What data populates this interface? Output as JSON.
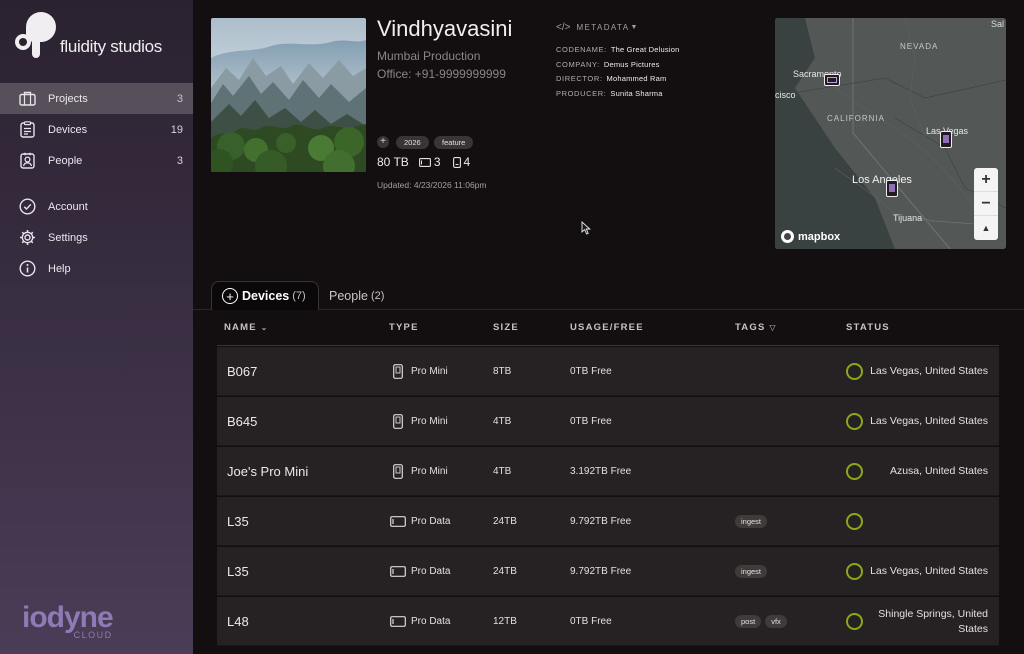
{
  "sidebar": {
    "brand": "fluidity studios",
    "items": [
      {
        "label": "Projects",
        "count": "3",
        "icon": "briefcase-icon"
      },
      {
        "label": "Devices",
        "count": "19",
        "icon": "clipboard-icon"
      },
      {
        "label": "People",
        "count": "3",
        "icon": "person-badge-icon"
      },
      {
        "label": "Account",
        "icon": "check-circle-icon"
      },
      {
        "label": "Settings",
        "icon": "gear-icon"
      },
      {
        "label": "Help",
        "icon": "info-icon"
      }
    ],
    "footer": {
      "wordmark": "iodyne",
      "sub": "CLOUD"
    }
  },
  "project": {
    "title": "Vindhyavasini",
    "subtitle": "Mumbai Production",
    "office": "Office: +91-9999999999",
    "tags": [
      "2026",
      "feature"
    ],
    "storage": "80 TB",
    "data_count": "3",
    "mini_count": "4",
    "updated": "Updated: 4/23/2026 11:06pm"
  },
  "metadata": {
    "header": "METADATA",
    "rows": [
      {
        "key": "CODENAME:",
        "value": "The Great Delusion"
      },
      {
        "key": "COMPANY:",
        "value": "Demus Pictures"
      },
      {
        "key": "DIRECTOR:",
        "value": "Mohammed Ram"
      },
      {
        "key": "PRODUCER:",
        "value": "Sunita Sharma"
      }
    ]
  },
  "map": {
    "labels": {
      "nevada": "NEVADA",
      "california": "CALIFORNIA",
      "sacramento": "Sacramento",
      "cisco": "cisco",
      "las_vegas": "Las Vegas",
      "los_angeles": "Los Angeles",
      "tijuana": "Tijuana",
      "sal": "Sal"
    },
    "attribution": "mapbox",
    "zoom_in": "+",
    "zoom_out": "−",
    "compass": "▲"
  },
  "tabs": [
    {
      "label": "Devices",
      "count": "(7)"
    },
    {
      "label": "People",
      "count": "(2)"
    }
  ],
  "table": {
    "columns": [
      "NAME",
      "TYPE",
      "SIZE",
      "USAGE/FREE",
      "TAGS",
      "STATUS"
    ],
    "rows": [
      {
        "name": "B067",
        "type": "Pro Mini",
        "size": "8TB",
        "usage": "0TB Free",
        "tags": [],
        "location": "Las Vegas, United States"
      },
      {
        "name": "B645",
        "type": "Pro Mini",
        "size": "4TB",
        "usage": "0TB Free",
        "tags": [],
        "location": "Las Vegas, United States"
      },
      {
        "name": "Joe's Pro Mini",
        "type": "Pro Mini",
        "size": "4TB",
        "usage": "3.192TB Free",
        "tags": [],
        "location": "Azusa, United States"
      },
      {
        "name": "L35",
        "type": "Pro Data",
        "size": "24TB",
        "usage": "9.792TB Free",
        "tags": [
          "ingest"
        ],
        "location": ""
      },
      {
        "name": "L35",
        "type": "Pro Data",
        "size": "24TB",
        "usage": "9.792TB Free",
        "tags": [
          "ingest"
        ],
        "location": "Las Vegas, United States"
      },
      {
        "name": "L48",
        "type": "Pro Data",
        "size": "12TB",
        "usage": "0TB Free",
        "tags": [
          "post",
          "vfx"
        ],
        "location": "Shingle Springs, United States"
      }
    ]
  },
  "colors": {
    "status_ring": "#8ea61a",
    "accent": "#8e7ab5"
  }
}
